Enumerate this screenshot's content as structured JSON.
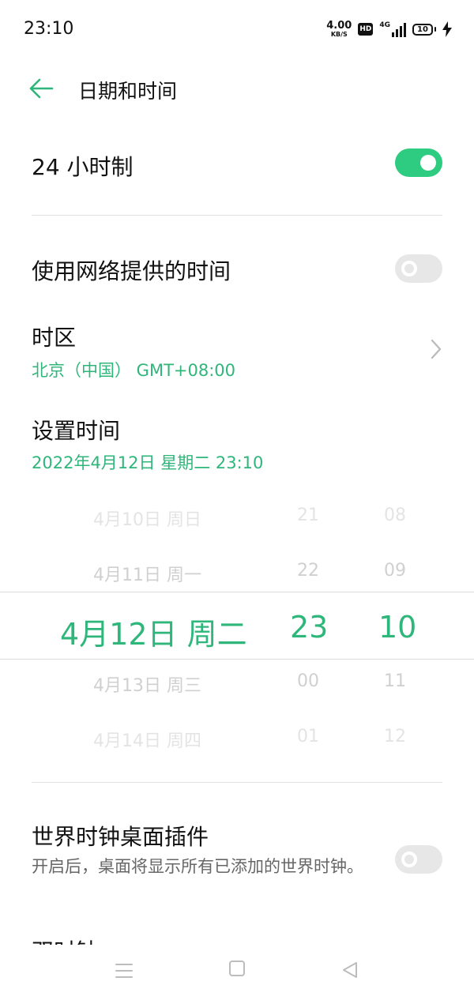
{
  "status_bar": {
    "time": "23:10",
    "net_speed_value": "4.00",
    "net_speed_unit": "KB/S",
    "hd_label": "HD",
    "network_tag": "4G",
    "battery_level": "10"
  },
  "header": {
    "title": "日期和时间"
  },
  "settings": {
    "hour24": {
      "label": "24 小时制",
      "enabled": true
    },
    "network_time": {
      "label": "使用网络提供的时间",
      "enabled": false
    },
    "timezone": {
      "label": "时区",
      "value": "北京（中国） GMT+08:00"
    },
    "set_time": {
      "label": "设置时间",
      "value": "2022年4月12日 星期二  23:10"
    },
    "world_clock": {
      "label": "世界时钟桌面插件",
      "description": "开启后，桌面将显示所有已添加的世界时钟。",
      "enabled": false
    },
    "next_partial_label": "双时钟"
  },
  "picker": {
    "dates": [
      "4月10日 周日",
      "4月11日 周一",
      "4月12日 周二",
      "4月13日 周三",
      "4月14日 周四"
    ],
    "hours": [
      "21",
      "22",
      "23",
      "00",
      "01"
    ],
    "minutes": [
      "08",
      "09",
      "10",
      "11",
      "12"
    ]
  },
  "colors": {
    "accent": "#2fb67a",
    "toggle_on": "#2ecc80",
    "toggle_off": "#e7e7e7"
  }
}
